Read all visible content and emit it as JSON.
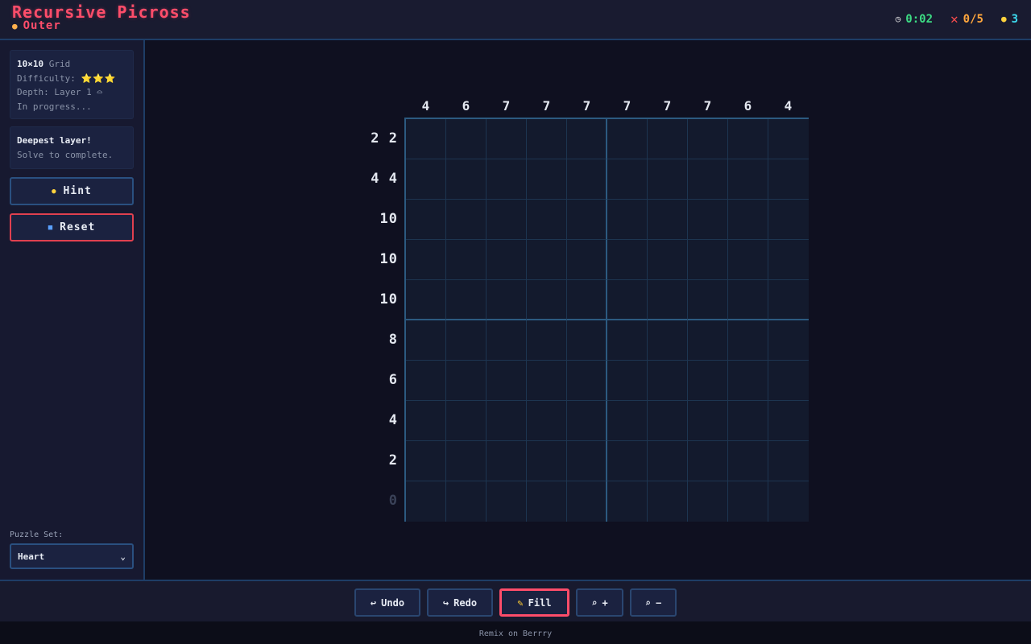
{
  "header": {
    "title": "Recursive Picross",
    "subtitle": "Outer",
    "subtitle_icon": "layer-icon",
    "timer": "0:02",
    "mistakes": "0/5",
    "hints": "3"
  },
  "sidebar": {
    "info": {
      "grid_size": "10×10",
      "grid_word": "Grid",
      "difficulty_label": "Difficulty:",
      "difficulty_stars": "⭐⭐⭐",
      "depth_text": "Depth: Layer 1 ⌓",
      "status": "In progress..."
    },
    "layer_card": {
      "heading": "Deepest layer!",
      "text": "Solve to complete."
    },
    "hint_label": "Hint",
    "reset_label": "Reset",
    "puzzle_set_label": "Puzzle Set:",
    "puzzle_set_value": "Heart"
  },
  "board": {
    "column_clues": [
      "4",
      "6",
      "7",
      "7",
      "7",
      "7",
      "7",
      "7",
      "6",
      "4"
    ],
    "row_clues": [
      "2 2",
      "4 4",
      "10",
      "10",
      "10",
      "8",
      "6",
      "4",
      "2",
      "0"
    ],
    "rows": 10,
    "cols": 10
  },
  "toolbar": {
    "undo_label": "Undo",
    "redo_label": "Redo",
    "fill_label": "Fill",
    "zoom_in_label": "+",
    "zoom_out_label": "−"
  },
  "footer": {
    "text": "Remix on Berrry"
  },
  "colors": {
    "accent": "#ff4d6a",
    "grid_border": "#2c5a80",
    "timer": "#3ddc84",
    "mistakes": "#ffa63d",
    "hints": "#3ddcf0"
  }
}
